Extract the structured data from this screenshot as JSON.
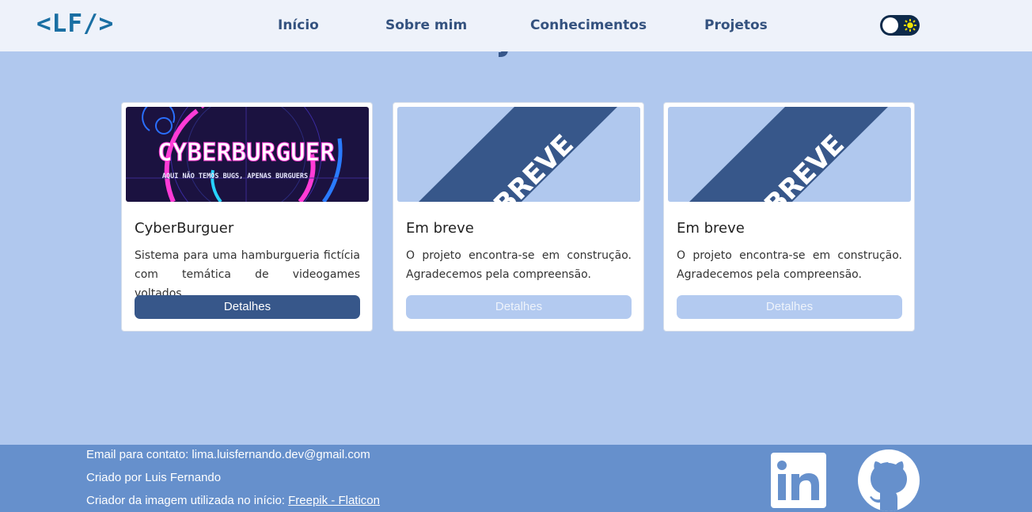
{
  "header": {
    "logo": "<LF/>",
    "nav": [
      "Início",
      "Sobre mim",
      "Conhecimentos",
      "Projetos"
    ]
  },
  "theme_toggle": {
    "state": "light",
    "icon": "sun-icon"
  },
  "projects": [
    {
      "title": "CyberBurguer",
      "description": "Sistema para uma hamburgueria fictícia com temática de videogames voltados...",
      "button": "Detalhes",
      "image_title": "CYBERBURGUER",
      "image_subtitle": "AQUI NÃO TEMOS BUGS, APENAS BURGUERS",
      "enabled": true
    },
    {
      "title": "Em breve",
      "description": "O projeto encontra-se em construção. Agradecemos pela compreensão.",
      "button": "Detalhes",
      "banner": "EM BREVE",
      "enabled": false
    },
    {
      "title": "Em breve",
      "description": "O projeto encontra-se em construção. Agradecemos pela compreensão.",
      "button": "Detalhes",
      "banner": "EM BREVE",
      "enabled": false
    }
  ],
  "footer": {
    "email_line": "Email para contato: lima.luisfernando.dev@gmail.com",
    "author_line": "Criado por Luis Fernando",
    "image_credit_prefix": "Criador da imagem utilizada no início: ",
    "image_credit_link": "Freepik - Flaticon",
    "social": [
      "linkedin-icon",
      "github-icon"
    ]
  },
  "colors": {
    "page_bg": "#b0c8ee",
    "header_bg": "#eef2fa",
    "primary": "#37578a",
    "footer_bg": "#6690cc",
    "logo": "#1a6fa3"
  }
}
